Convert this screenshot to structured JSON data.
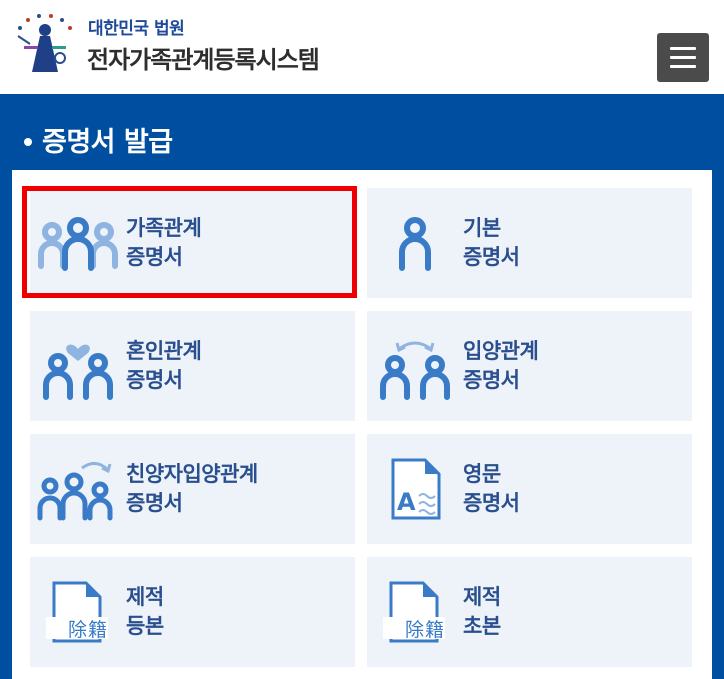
{
  "header": {
    "court_name": "대한민국 법원",
    "site_name": "전자가족관계등록시스템",
    "logo_icon": "court-emblem-icon",
    "menu_icon": "hamburger-menu-icon"
  },
  "panel": {
    "title": "증명서 발급",
    "background_color": "#004e9f"
  },
  "cards": [
    {
      "line1": "가족관계",
      "line2": "증명서",
      "icon": "family-group-icon",
      "selected": true
    },
    {
      "line1": "기본",
      "line2": "증명서",
      "icon": "single-person-icon"
    },
    {
      "line1": "혼인관계",
      "line2": "증명서",
      "icon": "couple-heart-icon"
    },
    {
      "line1": "입양관계",
      "line2": "증명서",
      "icon": "couple-exchange-icon"
    },
    {
      "line1": "친양자입양관계",
      "line2": "증명서",
      "icon": "family-exchange-icon"
    },
    {
      "line1": "영문",
      "line2": "증명서",
      "icon": "english-document-icon"
    },
    {
      "line1": "제적",
      "line2": "등본",
      "icon": "removed-record-document-icon",
      "icon_text": "除籍"
    },
    {
      "line1": "제적",
      "line2": "초본",
      "icon": "removed-record-document-icon",
      "icon_text": "除籍"
    }
  ],
  "colors": {
    "icon_blue": "#3a7bc8",
    "icon_light": "#8fb4e0",
    "label_text": "#2a4f8e",
    "card_bg": "#eef3fa",
    "highlight": "#ee0000"
  }
}
